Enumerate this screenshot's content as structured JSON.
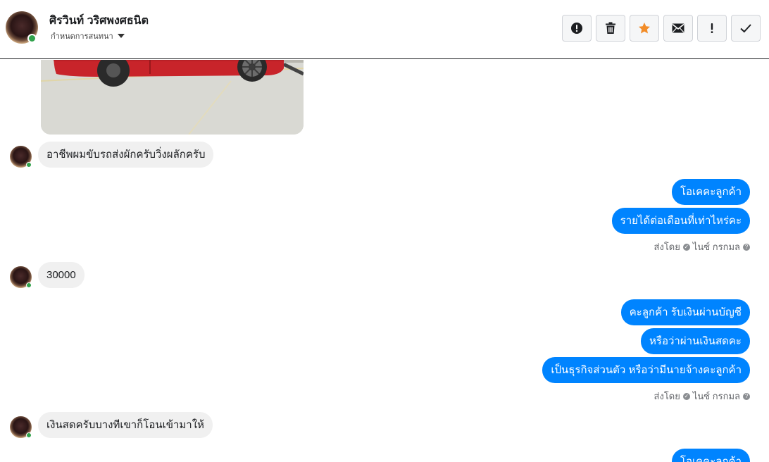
{
  "header": {
    "contact_name": "ศิรวินท์ วริศพงศธนิต",
    "assign_label": "กำหนดการสนทนา",
    "toolbar": [
      {
        "name": "spam-button",
        "icon": "alert-circle-icon"
      },
      {
        "name": "delete-button",
        "icon": "trash-icon"
      },
      {
        "name": "star-button",
        "icon": "star-icon"
      },
      {
        "name": "mark-unread-button",
        "icon": "envelope-icon"
      },
      {
        "name": "important-button",
        "icon": "exclamation-icon"
      },
      {
        "name": "done-button",
        "icon": "check-icon"
      }
    ]
  },
  "messages": {
    "m1": "อาชีพผมขับรถส่งผักครับวิ่งผลักครับ",
    "m2": "โอเคคะลูกค้า",
    "m3": "รายได้ต่อเดือนที่เท่าไหร่คะ",
    "m4": "30000",
    "m5": "คะลูกค้า รับเงินผ่านบัญชี",
    "m6": "หรือว่าผ่านเงินสดคะ",
    "m7": "เป็นธุรกิจส่วนตัว หรือว่ามีนายจ้างคะลูกค้า",
    "m8": "เงินสดครับบางทีเขาก็โอนเข้ามาให้",
    "m9": "โอเคคะลูกค้า"
  },
  "sent_by": {
    "label": "ส่งโดย",
    "agent": "ไนซ์ กรกมล"
  },
  "colors": {
    "outgoing_bubble": "#0084ff",
    "incoming_bubble": "#f0f0f0",
    "star": "#f28c28"
  }
}
